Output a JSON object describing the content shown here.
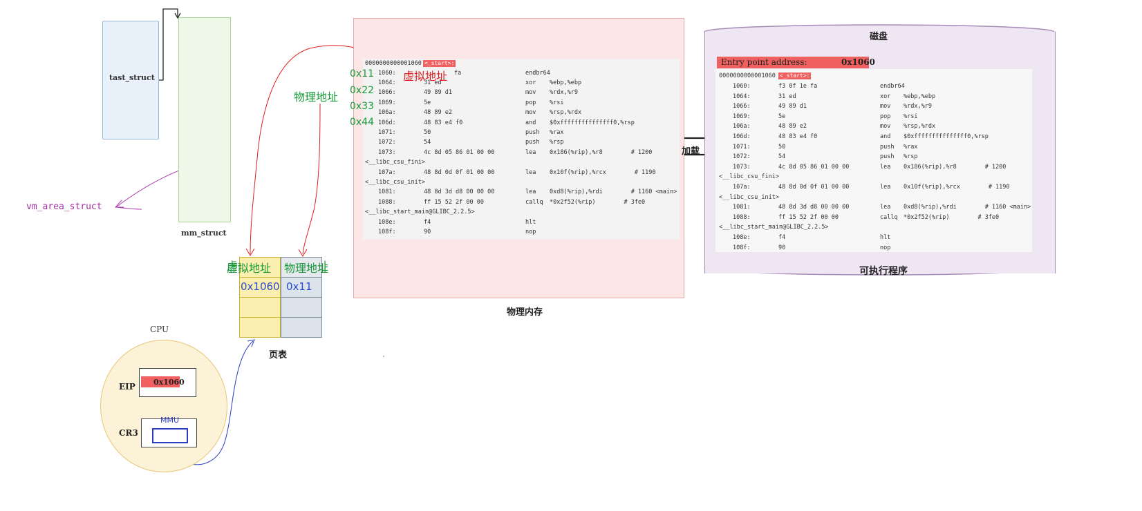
{
  "left": {
    "tast_struct": "tast_struct",
    "mm_struct": "mm_struct",
    "vm_area_struct": "vm_area_struct"
  },
  "page_table": {
    "header_virtual": "虚拟地址",
    "header_physical": "物理地址",
    "row1_virtual": "0x1060",
    "row1_physical": "0x11",
    "caption": "页表"
  },
  "memory": {
    "caption": "物理内存",
    "addresses": [
      "0x11",
      "0x22",
      "0x33",
      "0x44"
    ],
    "virtual_label": "虚拟地址",
    "physical_label": "物理地址",
    "start_label": "<_start>:",
    "header_addr": "0000000000001060",
    "lines": [
      {
        "a": "1064:",
        "h": "31 ed",
        "op": "xor",
        "arg": "%ebp,%ebp"
      },
      {
        "a": "1066:",
        "h": "49 89 d1",
        "op": "mov",
        "arg": "%rdx,%r9"
      },
      {
        "a": "1069:",
        "h": "5e",
        "op": "pop",
        "arg": "%rsi"
      },
      {
        "a": "106a:",
        "h": "48 89 e2",
        "op": "mov",
        "arg": "%rsp,%rdx"
      },
      {
        "a": "106d:",
        "h": "48 83 e4 f0",
        "op": "and",
        "arg": "$0xfffffffffffffff0,%rsp"
      },
      {
        "a": "1071:",
        "h": "50",
        "op": "push",
        "arg": "%rax"
      },
      {
        "a": "1072:",
        "h": "54",
        "op": "push",
        "arg": "%rsp"
      },
      {
        "a": "1073:",
        "h": "4c 8d 05 86 01 00 00",
        "op": "lea",
        "arg": "0x186(%rip),%r8        # 1200"
      },
      {
        "a": "",
        "h": "",
        "op": "",
        "arg": "",
        "sym": "<__libc_csu_fini>"
      },
      {
        "a": "107a:",
        "h": "48 8d 0d 0f 01 00 00",
        "op": "lea",
        "arg": "0x10f(%rip),%rcx        # 1190"
      },
      {
        "a": "",
        "h": "",
        "op": "",
        "arg": "",
        "sym": "<__libc_csu_init>"
      },
      {
        "a": "1081:",
        "h": "48 8d 3d d8 00 00 00",
        "op": "lea",
        "arg": "0xd8(%rip),%rdi        # 1160 <main>"
      },
      {
        "a": "1088:",
        "h": "ff 15 52 2f 00 00",
        "op": "callq",
        "arg": "*0x2f52(%rip)        # 3fe0"
      },
      {
        "a": "",
        "h": "",
        "op": "",
        "arg": "",
        "sym": "<__libc_start_main@GLIBC_2.2.5>"
      },
      {
        "a": "108e:",
        "h": "f4",
        "op": "hlt",
        "arg": ""
      },
      {
        "a": "108f:",
        "h": "90",
        "op": "nop",
        "arg": ""
      }
    ],
    "line0_hex_tail": "fa",
    "line0_op": "endbr64",
    "line0_addr": "1060:"
  },
  "load_label": "加载",
  "disk": {
    "title": "磁盘",
    "caption": "可执行程序",
    "entry_label": "Entry point address:",
    "entry_value": "0x1060",
    "header_addr": "0000000000001060",
    "start_label": "<_start>:",
    "lines": [
      {
        "a": "1060:",
        "h": "f3 0f 1e fa",
        "op": "endbr64",
        "arg": ""
      },
      {
        "a": "1064:",
        "h": "31 ed",
        "op": "xor",
        "arg": "%ebp,%ebp"
      },
      {
        "a": "1066:",
        "h": "49 89 d1",
        "op": "mov",
        "arg": "%rdx,%r9"
      },
      {
        "a": "1069:",
        "h": "5e",
        "op": "pop",
        "arg": "%rsi"
      },
      {
        "a": "106a:",
        "h": "48 89 e2",
        "op": "mov",
        "arg": "%rsp,%rdx"
      },
      {
        "a": "106d:",
        "h": "48 83 e4 f0",
        "op": "and",
        "arg": "$0xfffffffffffffff0,%rsp"
      },
      {
        "a": "1071:",
        "h": "50",
        "op": "push",
        "arg": "%rax"
      },
      {
        "a": "1072:",
        "h": "54",
        "op": "push",
        "arg": "%rsp"
      },
      {
        "a": "1073:",
        "h": "4c 8d 05 86 01 00 00",
        "op": "lea",
        "arg": "0x186(%rip),%r8        # 1200"
      },
      {
        "a": "",
        "h": "",
        "op": "",
        "arg": "",
        "sym": "<__libc_csu_fini>"
      },
      {
        "a": "107a:",
        "h": "48 8d 0d 0f 01 00 00",
        "op": "lea",
        "arg": "0x10f(%rip),%rcx        # 1190"
      },
      {
        "a": "",
        "h": "",
        "op": "",
        "arg": "",
        "sym": "<__libc_csu_init>"
      },
      {
        "a": "1081:",
        "h": "48 8d 3d d8 00 00 00",
        "op": "lea",
        "arg": "0xd8(%rip),%rdi        # 1160 <main>"
      },
      {
        "a": "1088:",
        "h": "ff 15 52 2f 00 00",
        "op": "callq",
        "arg": "*0x2f52(%rip)        # 3fe0"
      },
      {
        "a": "",
        "h": "",
        "op": "",
        "arg": "",
        "sym": "<__libc_start_main@GLIBC_2.2.5>"
      },
      {
        "a": "108e:",
        "h": "f4",
        "op": "hlt",
        "arg": ""
      },
      {
        "a": "108f:",
        "h": "90",
        "op": "nop",
        "arg": ""
      }
    ]
  },
  "cpu": {
    "title": "CPU",
    "eip_label": "EIP",
    "eip_value": "0x1060",
    "cr3_label": "CR3",
    "mmu_label": "MMU"
  },
  "colors": {
    "red_highlight": "#f06060",
    "green_text": "#1a9a3a",
    "blue_text": "#2a4cd0",
    "purple_text": "#a030a0"
  }
}
